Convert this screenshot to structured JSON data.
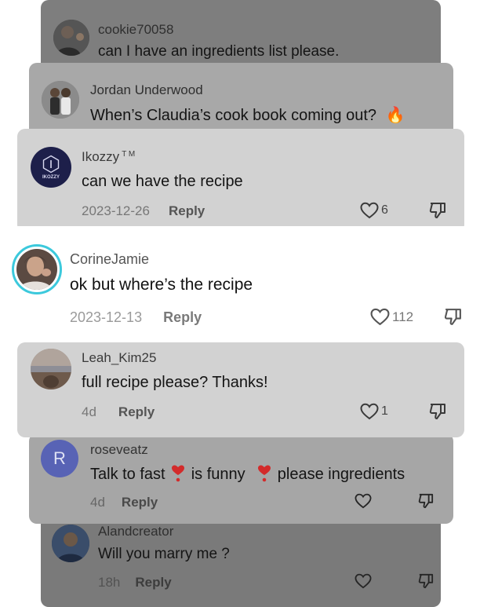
{
  "comments": [
    {
      "username": "cookie70058",
      "text": "can I have an ingredients list please.",
      "avatar_icon": "person-photo-avatar"
    },
    {
      "username": "Jordan Underwood",
      "text": "When’s Claudia’s cook book coming out?",
      "emoji": "🔥",
      "avatar_icon": "person-photo-avatar"
    },
    {
      "username": "Ikozzy",
      "username_badge": "T M",
      "text": "can we have the recipe",
      "date": "2023-12-26",
      "reply_label": "Reply",
      "likes": "6",
      "avatar_icon": "ikozzy-logo-avatar",
      "avatar_text": "IKOZZY"
    },
    {
      "username": "CorineJamie",
      "text": "ok but where’s the recipe",
      "date": "2023-12-13",
      "reply_label": "Reply",
      "likes": "112",
      "avatar_icon": "person-photo-avatar"
    },
    {
      "username": "Leah_Kim25",
      "text": "full recipe please? Thanks!",
      "date": "4d",
      "reply_label": "Reply",
      "likes": "1",
      "avatar_icon": "sunset-photo-avatar"
    },
    {
      "username": "roseveatz",
      "text_parts": [
        "Talk to fast",
        "is funny",
        "please ingredients"
      ],
      "date": "4d",
      "reply_label": "Reply",
      "likes": "",
      "avatar_letter": "R",
      "avatar_icon": "letter-avatar"
    },
    {
      "username": "Alandcreator",
      "text": "Will you marry me ?",
      "date": "18h",
      "reply_label": "Reply",
      "likes": "",
      "avatar_icon": "person-photo-avatar"
    }
  ],
  "colors": {
    "card_bottom": "#7a7a7a",
    "card_mid": "#a6a6a6",
    "card_light": "#d2d2d2",
    "focus_ring": "#3cc9dc",
    "avatar_letter_bg": "#5863b5",
    "heart_emoji": "#e03a3a"
  }
}
